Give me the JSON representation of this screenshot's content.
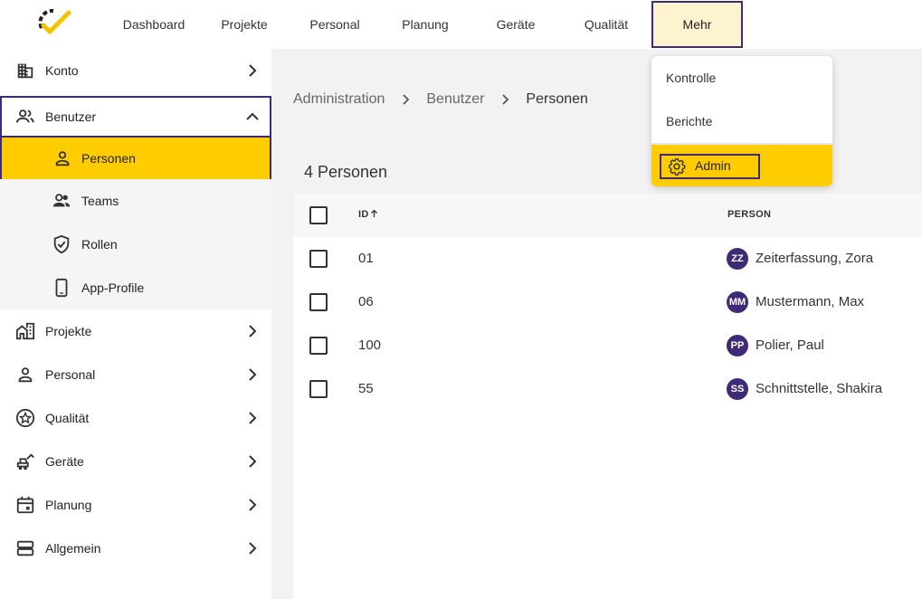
{
  "topnav": {
    "items": [
      {
        "label": "Dashboard"
      },
      {
        "label": "Projekte"
      },
      {
        "label": "Personal"
      },
      {
        "label": "Planung"
      },
      {
        "label": "Geräte"
      },
      {
        "label": "Qualität"
      },
      {
        "label": "Mehr"
      }
    ],
    "more_menu": {
      "items": [
        {
          "label": "Kontrolle"
        },
        {
          "label": "Berichte"
        },
        {
          "label": "Admin",
          "icon": "gear-icon"
        }
      ]
    }
  },
  "sidebar": {
    "items": [
      {
        "label": "Konto",
        "icon": "building-icon"
      },
      {
        "label": "Benutzer",
        "icon": "users-icon"
      },
      {
        "label": "Personen",
        "icon": "person-icon"
      },
      {
        "label": "Teams",
        "icon": "team-icon"
      },
      {
        "label": "Rollen",
        "icon": "shield-check-icon"
      },
      {
        "label": "App-Profile",
        "icon": "smartphone-icon"
      },
      {
        "label": "Projekte",
        "icon": "buildings-icon"
      },
      {
        "label": "Personal",
        "icon": "person-icon"
      },
      {
        "label": "Qualität",
        "icon": "star-badge-icon"
      },
      {
        "label": "Geräte",
        "icon": "excavator-icon"
      },
      {
        "label": "Planung",
        "icon": "calendar-icon"
      },
      {
        "label": "Allgemein",
        "icon": "storage-icon"
      }
    ]
  },
  "breadcrumb": {
    "items": [
      {
        "label": "Administration"
      },
      {
        "label": "Benutzer"
      },
      {
        "label": "Personen"
      }
    ]
  },
  "main": {
    "count_title": "4 Personen"
  },
  "table": {
    "headers": {
      "id": "ID",
      "person": "PERSON"
    },
    "rows": [
      {
        "id": "01",
        "initials": "ZZ",
        "name": "Zeiterfassung, Zora"
      },
      {
        "id": "06",
        "initials": "MM",
        "name": "Mustermann, Max"
      },
      {
        "id": "100",
        "initials": "PP",
        "name": "Polier, Paul"
      },
      {
        "id": "55",
        "initials": "SS",
        "name": "Schnittstelle, Shakira"
      }
    ]
  },
  "colors": {
    "accent_yellow": "#ffcc00",
    "highlight_purple": "#3f2a78",
    "avatar_bg": "#3f2a78"
  }
}
